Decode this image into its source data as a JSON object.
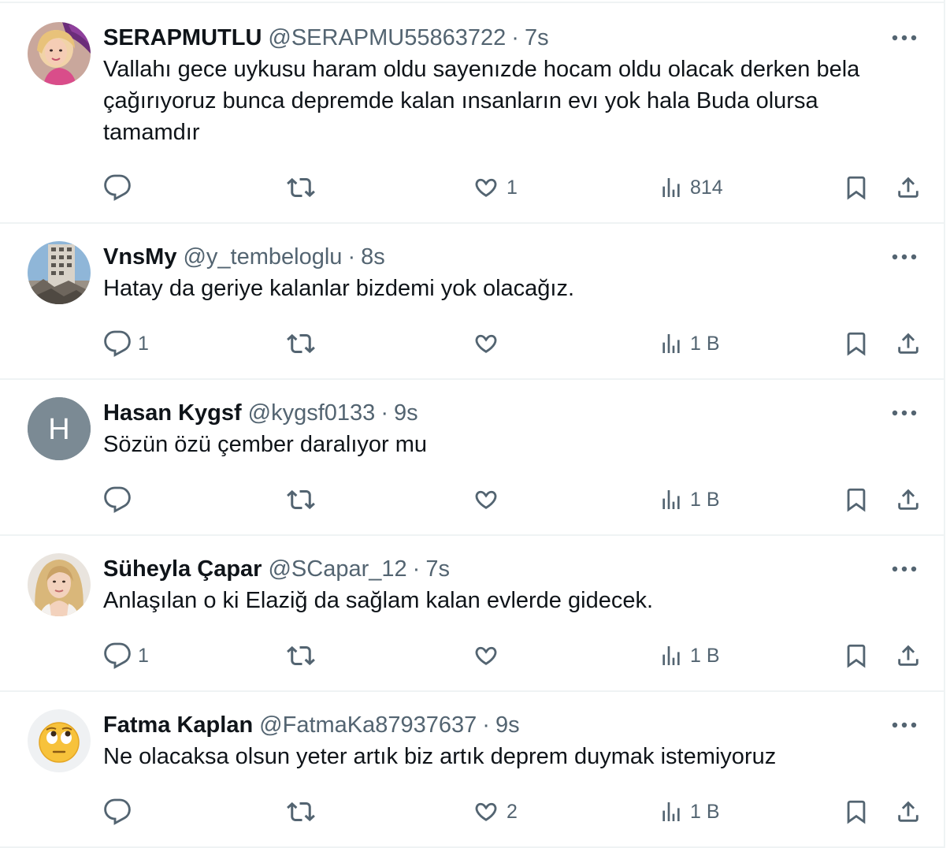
{
  "tweets": [
    {
      "name": "SERAPMUTLU",
      "handle": "@SERAPMU55863722",
      "dot": "·",
      "time": "7s",
      "text": "Vallahı gece uykusu haram oldu sayenızde hocam oldu olacak derken bela\nçağırıyoruz bunca depremde kalan ınsanların evı yok hala Buda olursa\ntamamdır",
      "replies": "",
      "retweets": "",
      "likes": "1",
      "views": "814",
      "avatar": "photo-woman-purple-hat"
    },
    {
      "name": "VnsMy",
      "handle": "@y_tembeloglu",
      "dot": "·",
      "time": "8s",
      "text": "Hatay da geriye kalanlar bizdemi yok olacağız.",
      "replies": "1",
      "retweets": "",
      "likes": "",
      "views": "1 B",
      "avatar": "photo-collapsed-building"
    },
    {
      "name": "Hasan Kygsf",
      "handle": "@kygsf0133",
      "dot": "·",
      "time": "9s",
      "text": "Sözün özü çember daralıyor mu",
      "replies": "",
      "retweets": "",
      "likes": "",
      "views": "1 B",
      "avatar": "initial",
      "initial": "H"
    },
    {
      "name": "Süheyla Çapar",
      "handle": "@SCapar_12",
      "dot": "·",
      "time": "7s",
      "text": "Anlaşılan o ki Elaziğ da sağlam kalan evlerde gidecek.",
      "replies": "1",
      "retweets": "",
      "likes": "",
      "views": "1 B",
      "avatar": "photo-woman-blonde"
    },
    {
      "name": "Fatma Kaplan",
      "handle": "@FatmaKa87937637",
      "dot": "·",
      "time": "9s",
      "text": "Ne olacaksa olsun yeter artık biz artık deprem duymak istemiyoruz",
      "replies": "",
      "retweets": "",
      "likes": "2",
      "views": "1 B",
      "avatar": "emoji-eye-roll"
    }
  ],
  "colors": {
    "text": "#0f1419",
    "secondary": "#536471",
    "border": "#eff3f4",
    "initial_avatar_bg": "#7b8a94"
  },
  "icons": {
    "reply": "reply-icon",
    "retweet": "retweet-icon",
    "like": "heart-icon",
    "views": "views-icon",
    "bookmark": "bookmark-icon",
    "share": "share-icon",
    "more": "more-icon"
  }
}
